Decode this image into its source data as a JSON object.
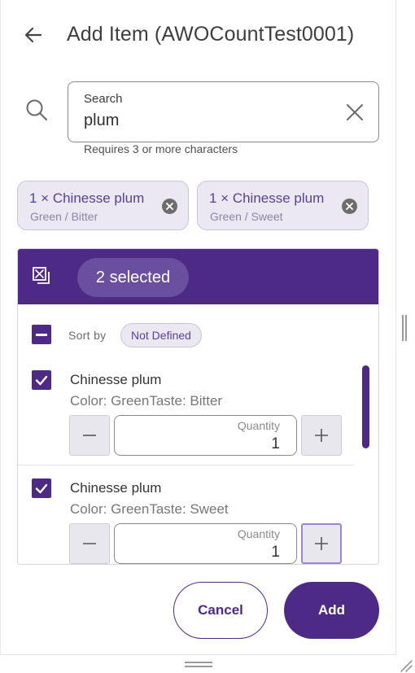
{
  "header": {
    "title": "Add Item (AWOCountTest0001)",
    "back_icon": "arrow-left-icon"
  },
  "search": {
    "label": "Search",
    "value": "plum",
    "hint": "Requires 3 or more characters"
  },
  "chips": [
    {
      "title": "1 × Chinesse plum",
      "subtitle": "Green / Bitter"
    },
    {
      "title": "1 × Chinesse plum",
      "subtitle": "Green / Sweet"
    }
  ],
  "selection": {
    "selected_text": "2 selected",
    "sort_label": "Sort by",
    "sort_value": "Not Defined"
  },
  "items": [
    {
      "name": "Chinesse plum",
      "attributes": "Color: GreenTaste: Bitter",
      "quantity_label": "Quantity",
      "quantity": "1",
      "checked": true
    },
    {
      "name": "Chinesse plum",
      "attributes": "Color: GreenTaste: Sweet",
      "quantity_label": "Quantity",
      "quantity": "1",
      "checked": true
    }
  ],
  "footer": {
    "cancel_label": "Cancel",
    "add_label": "Add"
  },
  "colors": {
    "accent": "#4d2a86",
    "chip_bg": "#ebe8f1",
    "chip_text": "#5a3f93"
  }
}
